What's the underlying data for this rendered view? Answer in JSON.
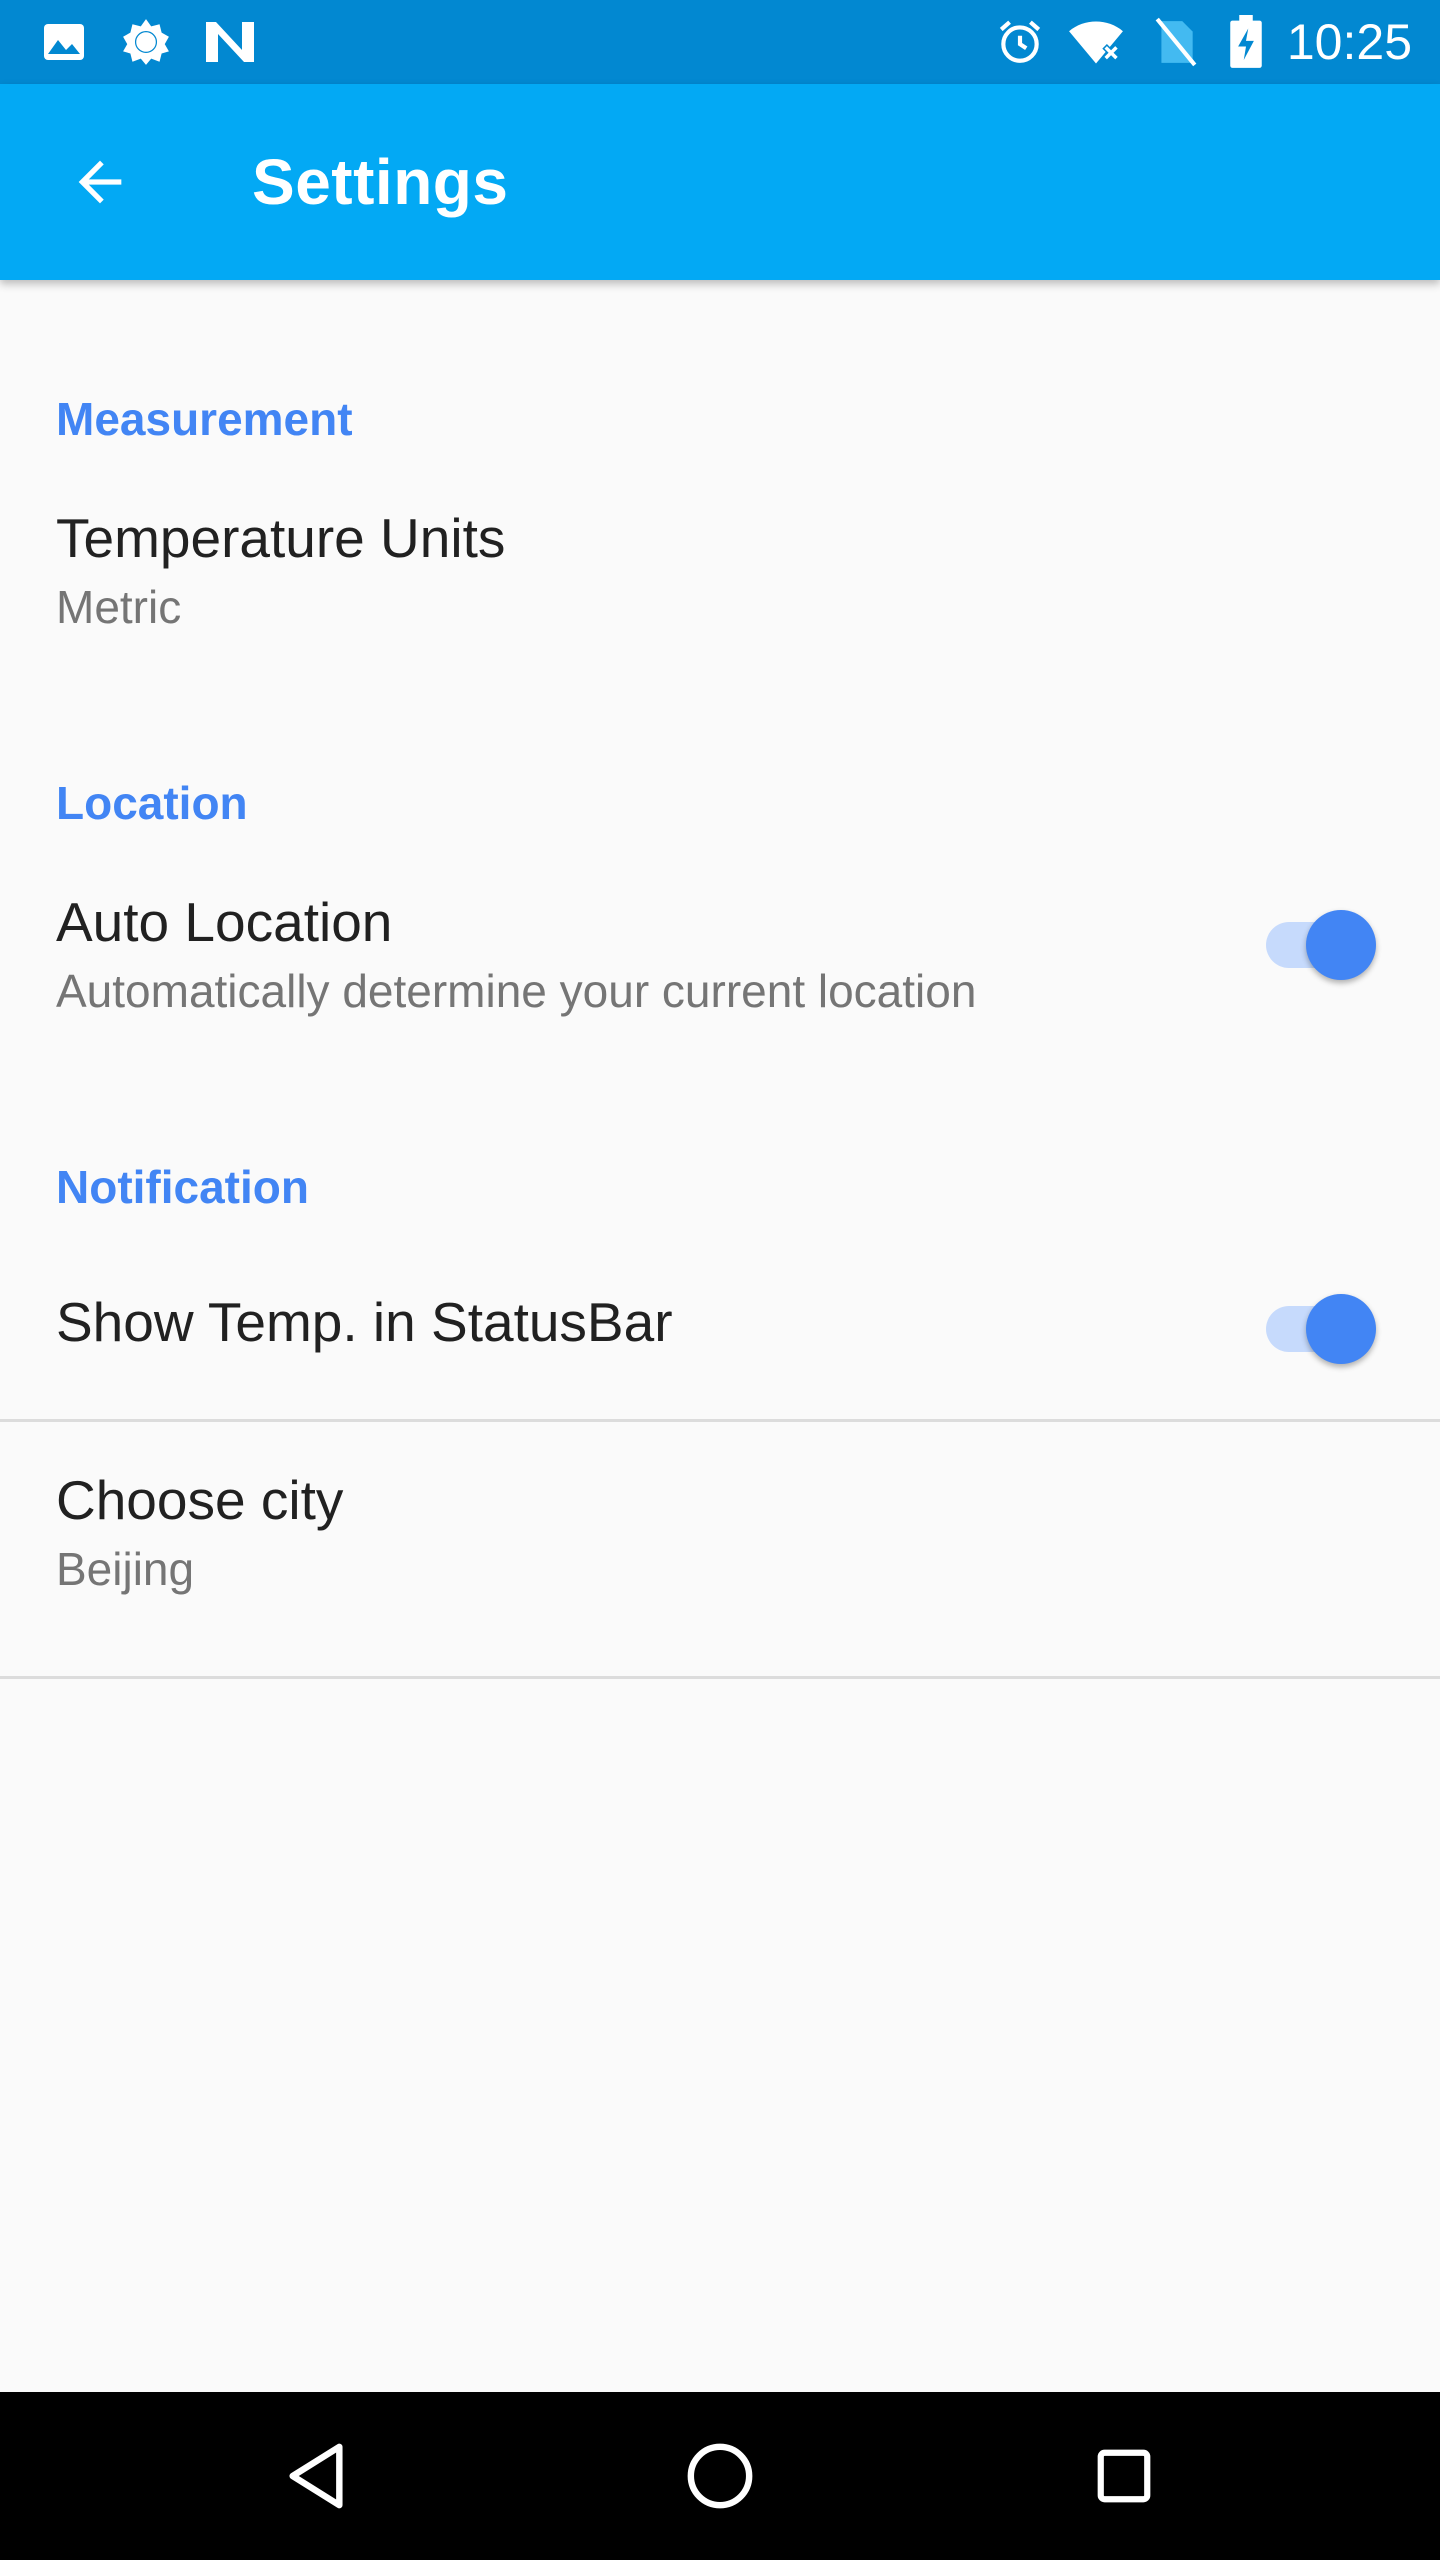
{
  "status_bar": {
    "time": "10:25",
    "left_icons": [
      "image-icon",
      "brightness-icon",
      "n-logo-icon"
    ],
    "right_icons": [
      "alarm-icon",
      "wifi-icon",
      "no-sim-icon",
      "battery-charging-icon"
    ]
  },
  "app_bar": {
    "title": "Settings",
    "color": "#03A9F4"
  },
  "sections": [
    {
      "header": "Measurement",
      "items": [
        {
          "title": "Temperature Units",
          "summary": "Metric"
        }
      ]
    },
    {
      "header": "Location",
      "items": [
        {
          "title": "Auto Location",
          "summary": "Automatically determine your current location",
          "switch_on": true
        }
      ]
    },
    {
      "header": "Notification",
      "items": [
        {
          "title": "Show Temp. in StatusBar",
          "switch_on": true
        }
      ]
    }
  ],
  "city": {
    "title": "Choose city",
    "summary": "Beijing"
  },
  "accent_color": "#4285F4",
  "nav_bar": {
    "buttons": [
      "back-triangle-icon",
      "home-circle-icon",
      "recents-square-icon"
    ]
  }
}
